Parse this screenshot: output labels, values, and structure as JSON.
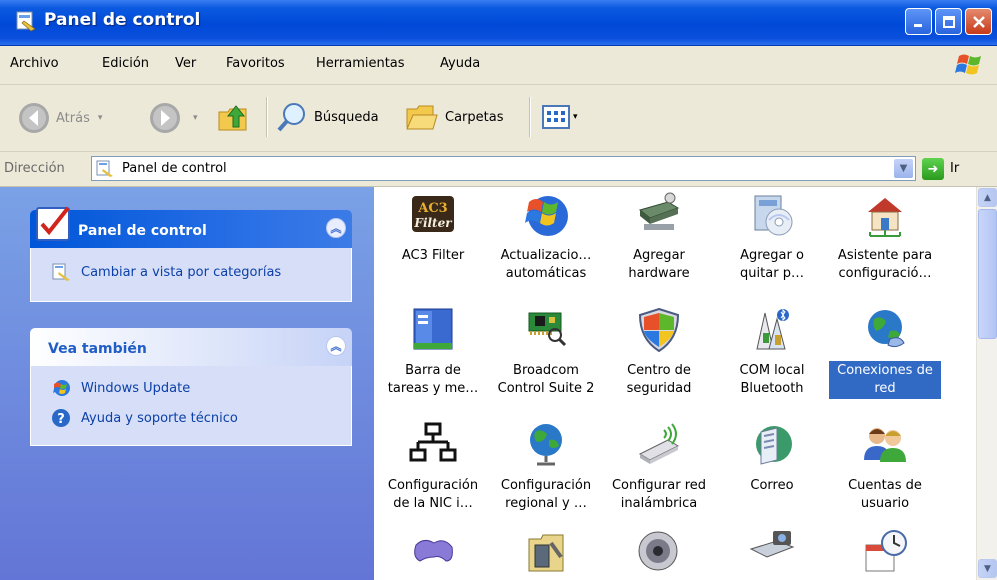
{
  "window": {
    "title": "Panel de control"
  },
  "menu": [
    "Archivo",
    "Edición",
    "Ver",
    "Favoritos",
    "Herramientas",
    "Ayuda"
  ],
  "toolbar": {
    "back_label": "Atrás",
    "search_label": "Búsqueda",
    "folders_label": "Carpetas"
  },
  "address": {
    "label": "Dirección",
    "value": "Panel de control",
    "go_label": "Ir"
  },
  "left_panes": {
    "control_panel": {
      "title": "Panel de control",
      "links": [
        "Cambiar a vista por categorías"
      ]
    },
    "see_also": {
      "title": "Vea también",
      "links": [
        "Windows Update",
        "Ayuda y soporte técnico"
      ]
    }
  },
  "items": [
    {
      "icon": "ac3-filter-icon",
      "line1": "AC3 Filter",
      "line2": ""
    },
    {
      "icon": "windows-update-icon",
      "line1": "Actualizacio…",
      "line2": "automáticas"
    },
    {
      "icon": "add-hardware-icon",
      "line1": "Agregar",
      "line2": "hardware"
    },
    {
      "icon": "add-remove-programs-icon",
      "line1": "Agregar o",
      "line2": "quitar p…"
    },
    {
      "icon": "network-setup-wizard-icon",
      "line1": "Asistente para",
      "line2": "configuració…"
    },
    {
      "icon": "taskbar-icon",
      "line1": "Barra de",
      "line2": "tareas y me…"
    },
    {
      "icon": "broadcom-card-icon",
      "line1": "Broadcom",
      "line2": "Control Suite 2"
    },
    {
      "icon": "security-center-shield-icon",
      "line1": "Centro de",
      "line2": "seguridad"
    },
    {
      "icon": "com-bluetooth-icon",
      "line1": "COM local",
      "line2": "Bluetooth"
    },
    {
      "icon": "network-connections-icon",
      "line1": "Conexiones de",
      "line2": "red"
    },
    {
      "icon": "nic-network-icon",
      "line1": "Configuración",
      "line2": "de la NIC i…"
    },
    {
      "icon": "regional-globe-icon",
      "line1": "Configuración",
      "line2": "regional y …"
    },
    {
      "icon": "wireless-adapter-icon",
      "line1": "Configurar red",
      "line2": "inalámbrica"
    },
    {
      "icon": "mail-icon",
      "line1": "Correo",
      "line2": ""
    },
    {
      "icon": "user-accounts-icon",
      "line1": "Cuentas de",
      "line2": "usuario"
    },
    {
      "icon": "game-controller-icon",
      "line1": "",
      "line2": ""
    },
    {
      "icon": "admin-tools-icon",
      "line1": "",
      "line2": ""
    },
    {
      "icon": "sounds-speaker-icon",
      "line1": "",
      "line2": ""
    },
    {
      "icon": "scanners-cameras-icon",
      "line1": "",
      "line2": ""
    },
    {
      "icon": "date-time-icon",
      "line1": "",
      "line2": ""
    }
  ],
  "selected_item": "Conexiones de red"
}
